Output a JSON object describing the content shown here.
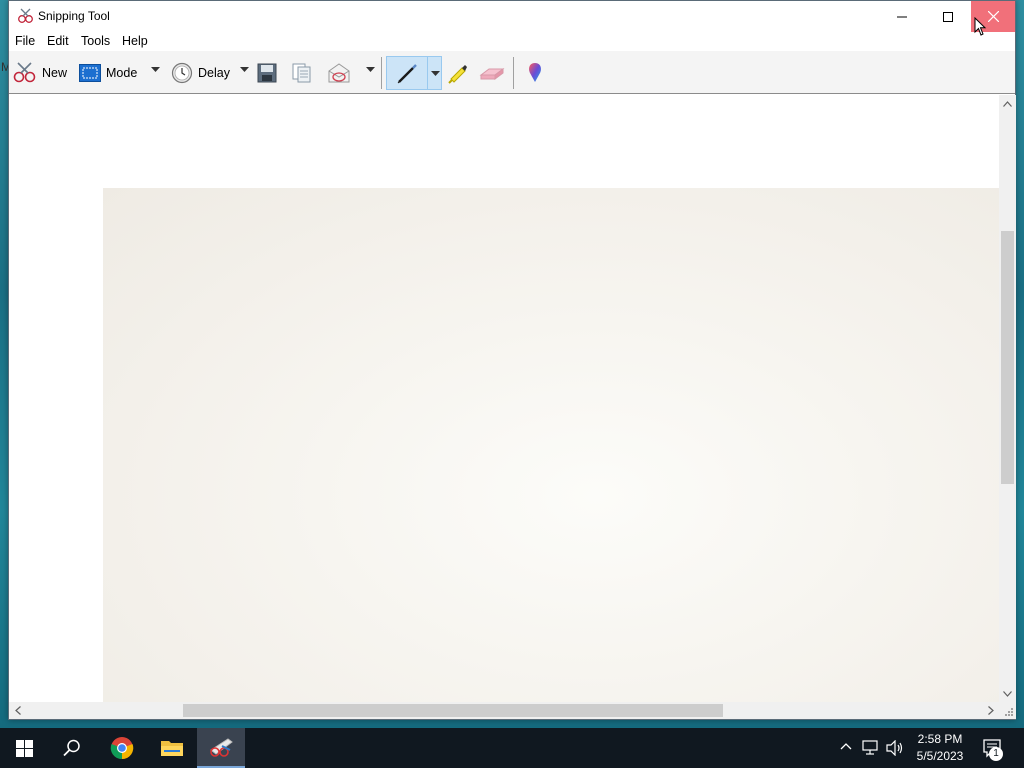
{
  "window": {
    "title": "Snipping Tool",
    "controls": {
      "minimize": "minimize",
      "maximize": "maximize",
      "close": "close"
    }
  },
  "menu": [
    "File",
    "Edit",
    "Tools",
    "Help"
  ],
  "toolbar": {
    "new_label": "New",
    "mode_label": "Mode",
    "delay_label": "Delay",
    "icons": [
      "scissors-icon",
      "mode-icon",
      "clock-icon",
      "save-icon",
      "copy-icon",
      "send-icon",
      "pen-icon",
      "highlighter-icon",
      "eraser-icon",
      "paint3d-icon"
    ]
  },
  "taskbar": {
    "apps": [
      "start",
      "search",
      "chrome",
      "file-explorer",
      "snipping-tool"
    ],
    "clock_time": "2:58 PM",
    "clock_date": "5/5/2023",
    "notification_count": "1"
  },
  "colors": {
    "close_hover": "#f1707a",
    "pen_selected": "#cce4f7",
    "taskbar": "#101820",
    "snip_background": "#f7f5f0"
  }
}
